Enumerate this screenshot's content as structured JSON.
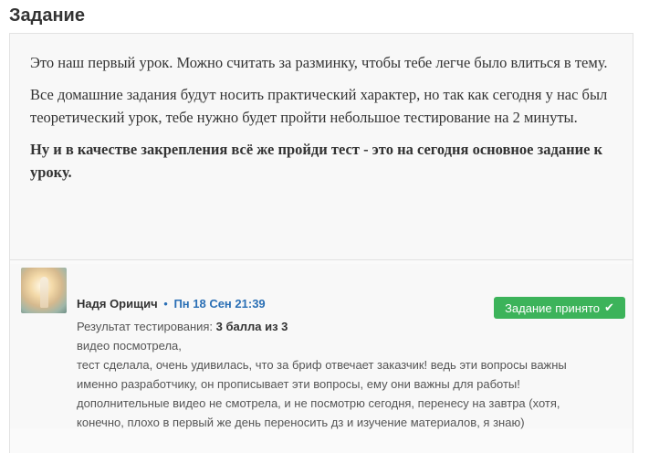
{
  "page": {
    "title": "Задание"
  },
  "task": {
    "paragraphs": [
      "Это наш первый урок. Можно считать за разминку, чтобы тебе легче было влиться в тему.",
      "Все домашние задания будут носить практический характер, но так как сегодня у нас был теоретический урок, тебе нужно будет пройти небольшое тестирование на 2 минуты."
    ],
    "bold_paragraph": "Ну и в качестве закрепления всё же пройди тест - это на сегодня основное задание к уроку."
  },
  "answer": {
    "author": "Надя Орищич",
    "separator": "•",
    "date": "Пн 18 Сен 21:39",
    "status_label": "Задание принято",
    "status_icon": "check-icon",
    "status_color": "#3cb35a",
    "result_label": "Результат тестирования:",
    "result_value": "3 балла из 3",
    "lines": [
      "видео посмотрела,",
      "тест сделала, очень удивилась, что за бриф отвечает заказчик! ведь эти вопросы важны",
      "именно разработчику, он прописывает эти вопросы, ему они важны для работы!",
      "дополнительные видео не смотрела, и не посмотрю сегодня, перенесу на завтра (хотя,",
      "конечно, плохо в первый же день переносить дз и изучение материалов, я знаю)"
    ]
  }
}
